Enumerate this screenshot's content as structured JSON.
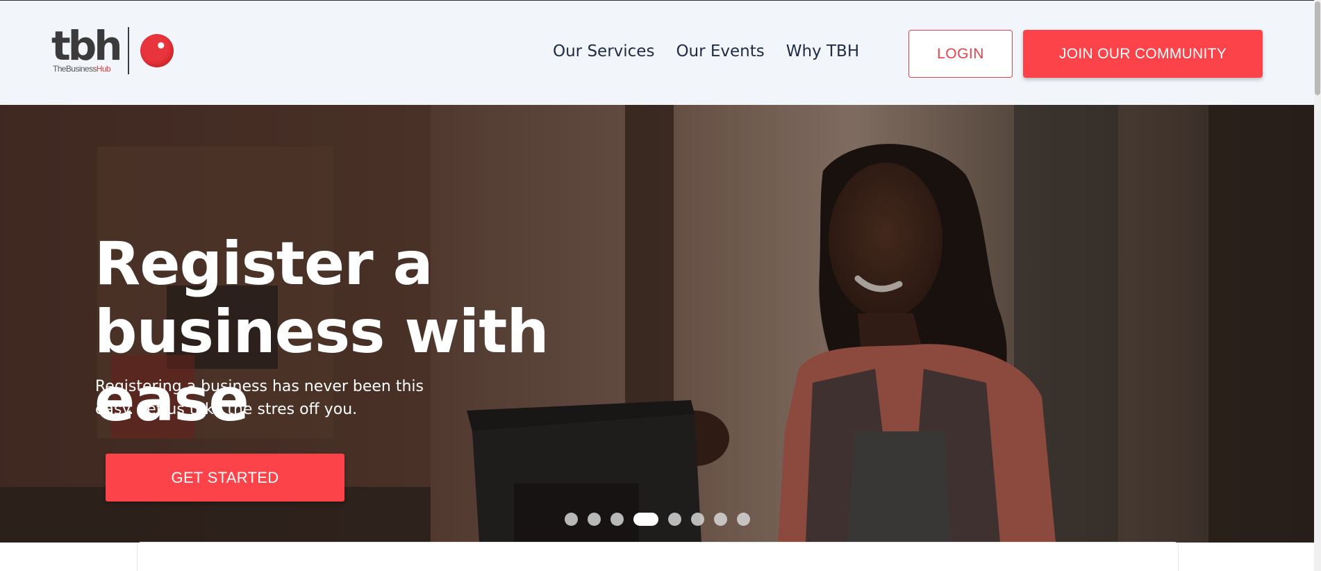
{
  "header": {
    "logo": {
      "wordmark": "tbh",
      "subtitle_prefix": "TheBusiness",
      "subtitle_suffix": "Hub"
    },
    "nav": [
      {
        "label": "Our Services"
      },
      {
        "label": "Our Events"
      },
      {
        "label": "Why TBH"
      }
    ],
    "login_label": "LOGIN",
    "join_label": "JOIN OUR COMMUNITY"
  },
  "hero": {
    "title": "Register a business with ease",
    "subtitle": "Registering a business has never been this easy. Let us take the stres off you.",
    "cta_label": "GET STARTED",
    "carousel": {
      "slide_count": 8,
      "active_index": 3
    }
  },
  "colors": {
    "accent": "#fc4349",
    "nav_text": "#1f2a44",
    "header_bg": "#f2f6fb"
  },
  "icons": [
    "tbh-logo-icon",
    "red-dot-logo-icon"
  ]
}
